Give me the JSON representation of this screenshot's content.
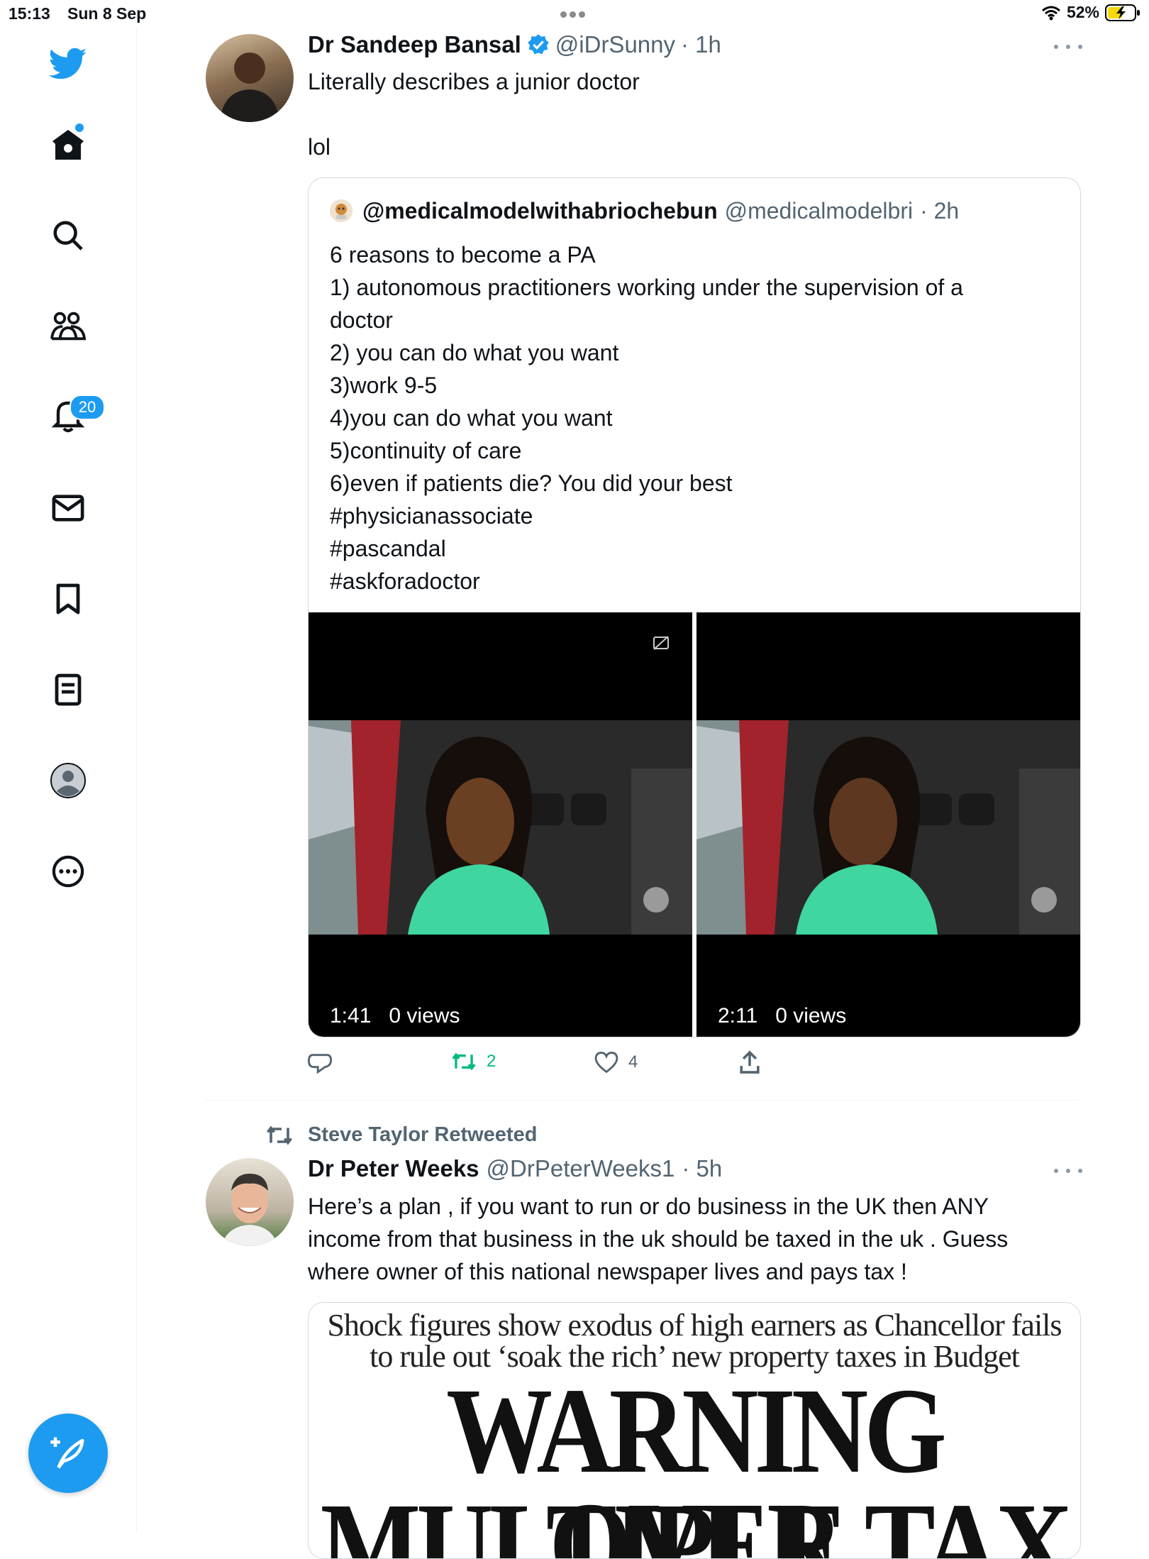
{
  "status_bar": {
    "time": "15:13",
    "date": "Sun 8 Sep",
    "battery": "52%"
  },
  "sidebar": {
    "notifications_count": "20"
  },
  "tweet1": {
    "name": "Dr Sandeep Bansal",
    "handle": "@iDrSunny",
    "time": "· 1h",
    "text_line1": "Literally describes a junior doctor",
    "text_line2": "lol",
    "quote": {
      "name": "@medicalmodelwithabriochebun",
      "handle": "@medicalmodelbri",
      "time": "· 2h",
      "lines": [
        "6 reasons to become a PA",
        "1) autonomous practitioners working under the supervision of a",
        "doctor",
        "2) you can do what you want",
        "3)work 9-5",
        "4)you can do what you want",
        "5)continuity of care",
        "6)even if patients die? You did your best",
        "#physicianassociate",
        "#pascandal",
        "#askforadoctor"
      ],
      "video1": {
        "duration": "1:41",
        "views": "0 views"
      },
      "video2": {
        "duration": "2:11",
        "views": "0 views"
      }
    },
    "actions": {
      "retweets": "2",
      "likes": "4"
    }
  },
  "tweet2": {
    "retweeted_by": "Steve Taylor Retweeted",
    "name": "Dr Peter Weeks",
    "handle": "@DrPeterWeeks1",
    "time": "· 5h",
    "lines": [
      "Here’s a plan , if you want to run or do business in the UK then ANY",
      "income from that business in the uk should be taxed in the uk . Guess",
      "where owner of this national newspaper lives and pays tax !"
    ],
    "news": {
      "sub1": "Shock figures show exodus of high earners as Chancellor fails",
      "sub2": "to rule out ‘soak the rich’ new property taxes in Budget",
      "head1": "WARNING OVER",
      "head2": "MULTIPLE TAX"
    }
  }
}
